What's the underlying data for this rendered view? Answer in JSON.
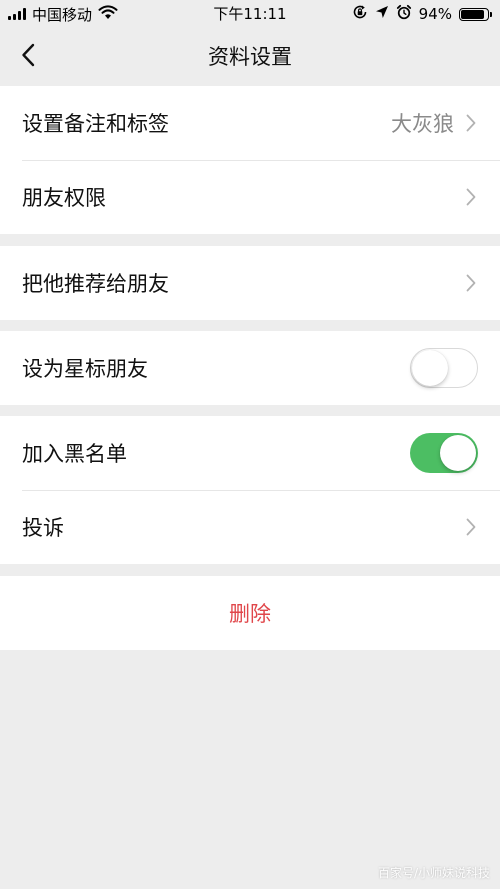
{
  "status_bar": {
    "carrier": "中国移动",
    "time": "下午11:11",
    "battery_text": "94%",
    "battery_level": 0.94,
    "icons": [
      "signal-icon",
      "wifi-icon",
      "rotation-lock-icon",
      "location-icon",
      "alarm-icon",
      "battery-icon"
    ]
  },
  "nav": {
    "title": "资料设置",
    "back_icon": "chevron-left-icon"
  },
  "groups": [
    {
      "rows": [
        {
          "label": "设置备注和标签",
          "value": "大灰狼",
          "type": "link"
        },
        {
          "label": "朋友权限",
          "type": "link"
        }
      ]
    },
    {
      "rows": [
        {
          "label": "把他推荐给朋友",
          "type": "link"
        }
      ]
    },
    {
      "rows": [
        {
          "label": "设为星标朋友",
          "type": "toggle",
          "on": false
        }
      ]
    },
    {
      "rows": [
        {
          "label": "加入黑名单",
          "type": "toggle",
          "on": true
        },
        {
          "label": "投诉",
          "type": "link"
        }
      ]
    }
  ],
  "delete": {
    "label": "删除"
  },
  "watermark": "百家号/小师妹说科技",
  "colors": {
    "background": "#ededed",
    "toggle_on": "#4cbe63",
    "delete_text": "#e0464a",
    "value_text": "#8a8a8a"
  }
}
